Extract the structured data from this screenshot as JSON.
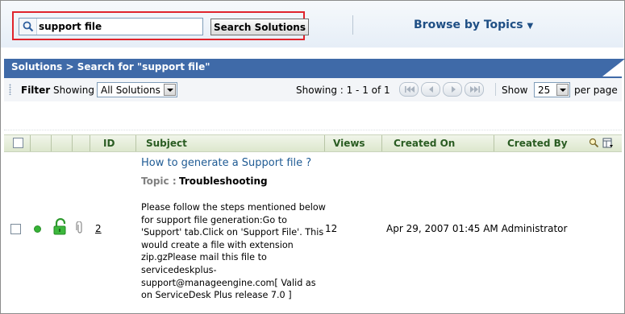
{
  "search": {
    "value": "support file",
    "button_label": "Search Solutions"
  },
  "browse": {
    "label": "Browse by Topics"
  },
  "title_bar": {
    "text": "Solutions > Search for \"support file\""
  },
  "filter_bar": {
    "filter_label": "Filter",
    "showing_label": "Showing",
    "filter_selected": "All Solutions",
    "range_text": "Showing : 1 - 1 of 1",
    "show_label": "Show",
    "per_page_selected": "25",
    "per_page_label": "per page"
  },
  "table": {
    "columns": [
      "ID",
      "Subject",
      "Views",
      "Created On",
      "Created By"
    ],
    "rows": [
      {
        "id": "2",
        "subject": "How to generate a Support file ?",
        "topic_label": "Topic :",
        "topic": "Troubleshooting",
        "description": "Please follow the steps mentioned below for support file generation:Go to 'Support' tab.Click on 'Support File'. This would create a file with extension zip.gzPlease mail this file to servicedeskplus-support@manageengine.com[ Valid as on ServiceDesk Plus release 7.0 ]",
        "views": "12",
        "created_on": "Apr 29, 2007 01:45 AM",
        "created_by": "Administrator",
        "status_color": "#36b336"
      }
    ]
  },
  "colors": {
    "title_band": "#3f6aa8",
    "header_text": "#2a5c22",
    "link": "#1f5b94",
    "highlight_border": "#e0242c"
  },
  "icons": [
    "search-icon",
    "chevron-down-icon",
    "first-page-icon",
    "prev-page-icon",
    "next-page-icon",
    "last-page-icon",
    "column-search-icon",
    "column-chooser-icon",
    "status-dot-icon",
    "unlock-icon",
    "attachment-icon"
  ]
}
